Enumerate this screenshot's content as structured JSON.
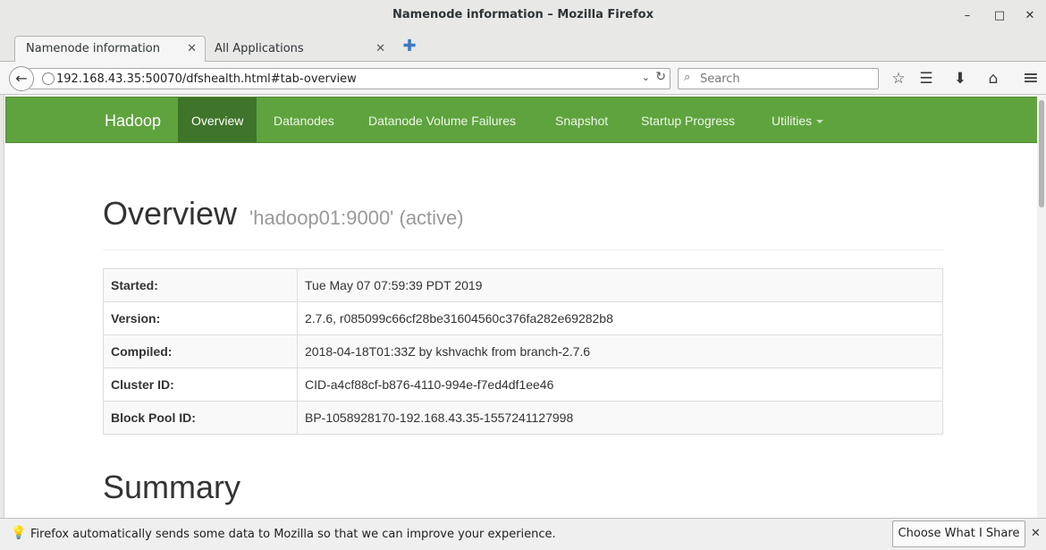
{
  "window": {
    "title": "Namenode information – Mozilla Firefox",
    "minimize_glyph": "–",
    "maximize_glyph": "□",
    "close_glyph": "✕"
  },
  "tabs": [
    {
      "label": "Namenode information",
      "active": true
    },
    {
      "label": "All Applications",
      "active": false
    }
  ],
  "tab_close_glyph": "✕",
  "new_tab_glyph": "✚",
  "navbar": {
    "back_glyph": "←",
    "url": "192.168.43.35:50070/dfshealth.html#tab-overview",
    "dropdown_glyph": "⌄",
    "reload_glyph": "↻",
    "search_placeholder": "Search",
    "search_glyph": "⌕",
    "icons": {
      "bookmark": "☆",
      "library": "☰",
      "download": "⬇",
      "home": "⌂",
      "menu": "≡"
    }
  },
  "hadoop_nav": {
    "brand": "Hadoop",
    "items": [
      "Overview",
      "Datanodes",
      "Datanode Volume Failures",
      "Snapshot",
      "Startup Progress",
      "Utilities"
    ],
    "active_index": 0
  },
  "overview": {
    "title": "Overview",
    "subtitle": "'hadoop01:9000' (active)",
    "rows": [
      {
        "label": "Started:",
        "value": "Tue May 07 07:59:39 PDT 2019"
      },
      {
        "label": "Version:",
        "value": "2.7.6, r085099c66cf28be31604560c376fa282e69282b8"
      },
      {
        "label": "Compiled:",
        "value": "2018-04-18T01:33Z by kshvachk from branch-2.7.6"
      },
      {
        "label": "Cluster ID:",
        "value": "CID-a4cf88cf-b876-4110-994e-f7ed4df1ee46"
      },
      {
        "label": "Block Pool ID:",
        "value": "BP-1058928170-192.168.43.35-1557241127998"
      }
    ]
  },
  "summary": {
    "title": "Summary"
  },
  "notification": {
    "bulb_glyph": "💡",
    "message": "Firefox automatically sends some data to Mozilla so that we can improve your experience.",
    "button": "Choose What I Share",
    "close_glyph": "✕"
  },
  "colors": {
    "hadoop_green": "#5fa33e",
    "hadoop_active": "#3f742b"
  }
}
